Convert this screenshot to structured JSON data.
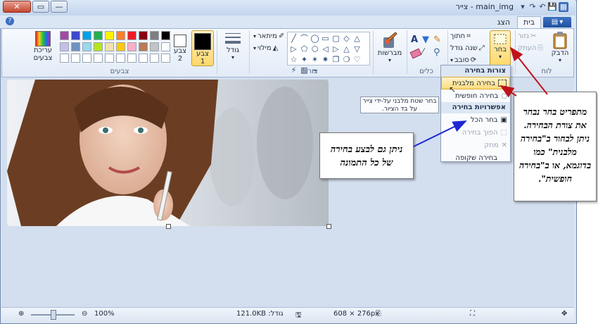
{
  "titlebar": {
    "title": "main_img - צייר",
    "close": "✕",
    "maximize": "▭",
    "minimize": "—"
  },
  "tabs": {
    "file": "▤",
    "home": "בית",
    "view": "הצג",
    "help": "?"
  },
  "clipboard": {
    "paste": "הדבק",
    "cut": "גזור",
    "copy": "העתק",
    "label": "לוח"
  },
  "image": {
    "select": "בחר",
    "crop": "חתוך",
    "resize": "שנה גודל",
    "rotate": "סובב",
    "label": "תמונה"
  },
  "tools": {
    "label": "כלים"
  },
  "brushes": {
    "label": "מברשות"
  },
  "shapes": {
    "outline": "מיתאר",
    "fill": "מילוי",
    "label": "צורות",
    "glyphs": [
      "╱",
      "⌒",
      "◯",
      "▭",
      "▢",
      "◇",
      "△",
      "▷",
      "⬠",
      "⬡",
      "◁",
      "▷",
      "△",
      "▽",
      "☆",
      "✦",
      "✶",
      "✷",
      "❒",
      "❍",
      "♡",
      "⚡",
      "▥",
      "⌁"
    ]
  },
  "size": {
    "label": "גודל"
  },
  "color1": {
    "label": "צבע 1",
    "color": "#000000"
  },
  "color2": {
    "label": "צבע 2",
    "color": "#ffffff"
  },
  "colors": {
    "label": "צבעים",
    "edit": "עריכת צבעים",
    "row1": [
      "#000000",
      "#7f7f7f",
      "#880015",
      "#ed1c24",
      "#ff7f27",
      "#fff200",
      "#22b14c",
      "#00a2e8",
      "#3f48cc",
      "#a349a4"
    ],
    "row2": [
      "#ffffff",
      "#c3c3c3",
      "#b97a57",
      "#ffaec9",
      "#ffc90e",
      "#efe4b0",
      "#b5e61d",
      "#99d9ea",
      "#7092be",
      "#c8bfe7"
    ]
  },
  "status": {
    "zoom": "100%",
    "dimensions": "608 × 276px",
    "size": "גודל: 121.0KB"
  },
  "select_menu": {
    "shapes_header": "צורות בחירה",
    "rect": "בחירה מלבנית",
    "free": "בחירה חופשית",
    "options_header": "אפשרויות בחירה",
    "select_all": "בחר הכל",
    "invert": "הפוך בחירה",
    "delete": "מחק",
    "transparent": "בחירה שקופה"
  },
  "tooltip": "בחר שטח מלבני על-ידי צייר על בד הציור.",
  "callouts": {
    "left": "ניתן גם לבצע בחירה של כל התמונה",
    "right": "מתפריט בחר נבחר את צורת הבחירה. ניתן לבחור ב\"בחירה מלבנית\" כמו בדוגמא, או ב\"בחירה חופשית\"."
  },
  "accent": {
    "blue_arrow": "#1f27d6",
    "red_arrow": "#c0121b",
    "highlight": "#ffd86b"
  }
}
